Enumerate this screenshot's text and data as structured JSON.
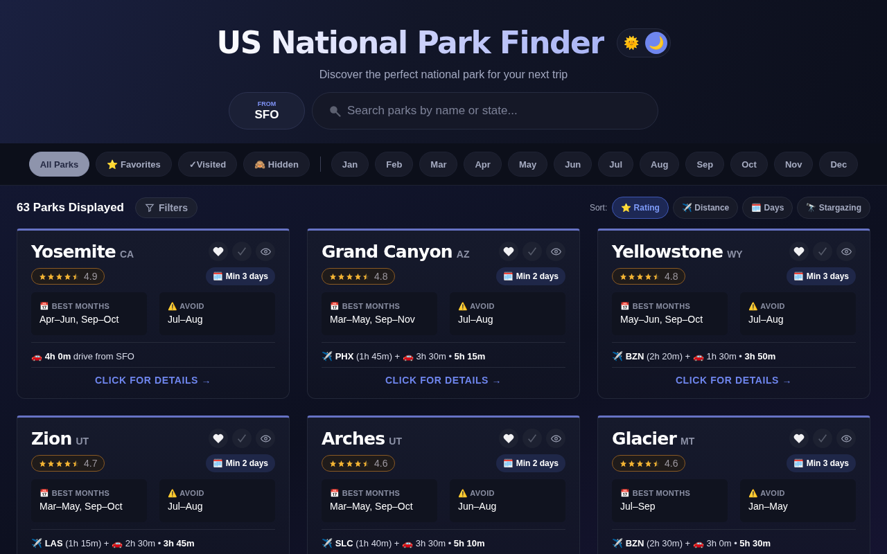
{
  "header": {
    "title": "US National Park Finder",
    "subtitle": "Discover the perfect national park for your next trip",
    "theme_toggle": [
      {
        "symbol": "🌞",
        "selected": false
      },
      {
        "symbol": "🌙",
        "selected": true
      }
    ],
    "origin": {
      "label": "FROM",
      "code": "SFO"
    },
    "search": {
      "placeholder": "Search parks by name or state..."
    }
  },
  "filters": [
    {
      "label": "All Parks",
      "selected": true
    },
    {
      "label": "⭐ Favorites",
      "selected": false
    },
    {
      "label": "✓Visited",
      "selected": false
    },
    {
      "label": "🙈 Hidden",
      "selected": false
    }
  ],
  "months": [
    {
      "label": "Jan",
      "selected": false
    },
    {
      "label": "Feb",
      "selected": false
    },
    {
      "label": "Mar",
      "selected": false
    },
    {
      "label": "Apr",
      "selected": false
    },
    {
      "label": "May",
      "selected": false
    },
    {
      "label": "Jun",
      "selected": false
    },
    {
      "label": "Jul",
      "selected": false
    },
    {
      "label": "Aug",
      "selected": false
    },
    {
      "label": "Sep",
      "selected": false
    },
    {
      "label": "Oct",
      "selected": false
    },
    {
      "label": "Nov",
      "selected": false
    },
    {
      "label": "Dec",
      "selected": false
    }
  ],
  "toolbar": {
    "count": "63 Parks Displayed",
    "filters_button": "Filters",
    "sort_label": "Sort:",
    "sort_options": [
      {
        "label": "⭐ Rating",
        "selected": true
      },
      {
        "label": "✈️ Distance",
        "selected": false
      },
      {
        "label": "🗓️ Days",
        "selected": false
      },
      {
        "label": "🔭 Stargazing",
        "selected": false
      }
    ]
  },
  "parks": [
    {
      "name": "Yosemite",
      "state": "CA",
      "stars": 4.5,
      "rating": "4.9",
      "min_days": "🗓️ Min 3 days",
      "best_label": "📅 BEST MONTHS",
      "best": "Apr–Jun, Sep–Oct",
      "avoid_label": "⚠️ AVOID",
      "avoid": "Jul–Aug",
      "travel": "🚗 **4h 0m** drive from SFO",
      "details": "CLICK FOR DETAILS →"
    },
    {
      "name": "Grand Canyon",
      "state": "AZ",
      "stars": 4.5,
      "rating": "4.8",
      "min_days": "🗓️ Min 2 days",
      "best_label": "📅 BEST MONTHS",
      "best": "Mar–May, Sep–Nov",
      "avoid_label": "⚠️ AVOID",
      "avoid": "Jul–Aug",
      "travel": "✈️ **PHX** (1h 45m) + 🚗 3h 30m • **5h 15m**",
      "details": "CLICK FOR DETAILS →"
    },
    {
      "name": "Yellowstone",
      "state": "WY",
      "stars": 4.5,
      "rating": "4.8",
      "min_days": "🗓️ Min 3 days",
      "best_label": "📅 BEST MONTHS",
      "best": "May–Jun, Sep–Oct",
      "avoid_label": "⚠️ AVOID",
      "avoid": "Jul–Aug",
      "travel": "✈️ **BZN** (2h 20m) + 🚗 1h 30m • **3h 50m**",
      "details": "CLICK FOR DETAILS →"
    },
    {
      "name": "Zion",
      "state": "UT",
      "stars": 4.5,
      "rating": "4.7",
      "min_days": "🗓️ Min 2 days",
      "best_label": "📅 BEST MONTHS",
      "best": "Mar–May, Sep–Oct",
      "avoid_label": "⚠️ AVOID",
      "avoid": "Jul–Aug",
      "travel": "✈️ **LAS** (1h 15m) + 🚗 2h 30m • **3h 45m**"
    },
    {
      "name": "Arches",
      "state": "UT",
      "stars": 4.5,
      "rating": "4.6",
      "min_days": "🗓️ Min 2 days",
      "best_label": "📅 BEST MONTHS",
      "best": "Mar–May, Sep–Oct",
      "avoid_label": "⚠️ AVOID",
      "avoid": "Jun–Aug",
      "travel": "✈️ **SLC** (1h 40m) + 🚗 3h 30m • **5h 10m**"
    },
    {
      "name": "Glacier",
      "state": "MT",
      "stars": 4.5,
      "rating": "4.6",
      "min_days": "🗓️ Min 3 days",
      "best_label": "📅 BEST MONTHS",
      "best": "Jul–Sep",
      "avoid_label": "⚠️ AVOID",
      "avoid": "Jan–May",
      "travel": "✈️ **BZN** (2h 30m) + 🚗 3h 0m • **5h 30m**"
    }
  ]
}
